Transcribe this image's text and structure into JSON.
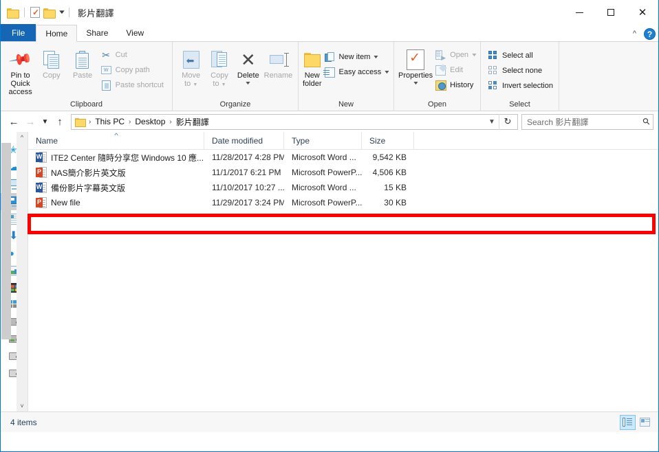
{
  "window": {
    "title": "影片翻譯",
    "quick_access": [
      {
        "name": "folder-icon",
        "label": "Folder"
      },
      {
        "name": "properties-icon",
        "label": "Properties"
      },
      {
        "name": "new-folder-icon",
        "label": "New folder"
      },
      {
        "name": "customize-caret-icon",
        "label": "Customize Quick Access Toolbar"
      }
    ],
    "controls": {
      "minimize": "Minimize",
      "maximize": "Maximize",
      "close": "Close"
    }
  },
  "ribbon": {
    "tabs": [
      {
        "label": "File",
        "active": false,
        "kind": "file"
      },
      {
        "label": "Home",
        "active": true,
        "kind": "normal"
      },
      {
        "label": "Share",
        "active": false,
        "kind": "normal"
      },
      {
        "label": "View",
        "active": false,
        "kind": "normal"
      }
    ],
    "collapse_label": "Minimize the Ribbon",
    "help_label": "?",
    "groups": {
      "clipboard": {
        "label": "Clipboard",
        "pin_line1": "Pin to Quick",
        "pin_line2": "access",
        "copy": "Copy",
        "paste": "Paste",
        "cut": "Cut",
        "copy_path": "Copy path",
        "paste_shortcut": "Paste shortcut"
      },
      "organize": {
        "label": "Organize",
        "move_to_line1": "Move",
        "move_to_line2": "to",
        "copy_to_line1": "Copy",
        "copy_to_line2": "to",
        "delete": "Delete",
        "rename": "Rename"
      },
      "new": {
        "label": "New",
        "new_folder_line1": "New",
        "new_folder_line2": "folder",
        "new_item": "New item",
        "easy_access": "Easy access"
      },
      "open": {
        "label": "Open",
        "properties": "Properties",
        "open": "Open",
        "edit": "Edit",
        "history": "History"
      },
      "select": {
        "label": "Select",
        "select_all": "Select all",
        "select_none": "Select none",
        "invert_selection": "Invert selection"
      }
    }
  },
  "navbar": {
    "back": "Back",
    "forward": "Forward",
    "recent": "Recent locations",
    "up": "Up",
    "breadcrumb": [
      "This PC",
      "Desktop",
      "影片翻譯"
    ],
    "dropdown": "Previous locations",
    "refresh": "Refresh",
    "search_placeholder": "Search 影片翻譯"
  },
  "nav_pane": {
    "items": [
      {
        "icon": "quick-access-star-icon",
        "label": "Quick access",
        "selected": false
      },
      {
        "icon": "onedrive-cloud-icon",
        "label": "OneDrive",
        "selected": false
      },
      {
        "icon": "this-pc-icon",
        "label": "This PC",
        "selected": false
      },
      {
        "icon": "desktop-icon",
        "label": "Desktop",
        "selected": true
      },
      {
        "icon": "documents-icon",
        "label": "Documents",
        "selected": false
      },
      {
        "icon": "downloads-icon",
        "label": "Downloads",
        "selected": false
      },
      {
        "icon": "music-icon",
        "label": "Music",
        "selected": false
      },
      {
        "icon": "pictures-icon",
        "label": "Pictures",
        "selected": false
      },
      {
        "icon": "videos-icon",
        "label": "Videos",
        "selected": false
      },
      {
        "icon": "windows-drive-icon",
        "label": "Local Disk",
        "selected": false
      },
      {
        "icon": "drive-icon",
        "label": "Drive",
        "selected": false
      },
      {
        "icon": "drive-green-icon",
        "label": "Drive",
        "selected": false
      },
      {
        "icon": "drive-grey-icon",
        "label": "Drive",
        "selected": false
      },
      {
        "icon": "drive-grey2-icon",
        "label": "Drive",
        "selected": false
      }
    ]
  },
  "file_list": {
    "columns": [
      {
        "key": "name",
        "label": "Name",
        "sorted": "asc"
      },
      {
        "key": "date",
        "label": "Date modified",
        "sorted": null
      },
      {
        "key": "type",
        "label": "Type",
        "sorted": null
      },
      {
        "key": "size",
        "label": "Size",
        "sorted": null
      }
    ],
    "rows": [
      {
        "icon": "word-document-icon",
        "badge": "W",
        "name": "ITE2 Center 隨時分享您 Windows 10 應...",
        "date": "11/28/2017 4:28 PM",
        "type": "Microsoft Word ...",
        "size": "9,542 KB",
        "highlighted": false
      },
      {
        "icon": "powerpoint-document-icon",
        "badge": "P",
        "name": "NAS簡介影片英文版",
        "date": "11/1/2017 6:21 PM",
        "type": "Microsoft PowerP...",
        "size": "4,506 KB",
        "highlighted": false
      },
      {
        "icon": "word-document-icon",
        "badge": "W",
        "name": "備份影片字幕英文版",
        "date": "11/10/2017 10:27 ...",
        "type": "Microsoft Word ...",
        "size": "15 KB",
        "highlighted": false
      },
      {
        "icon": "powerpoint-document-icon",
        "badge": "P",
        "name": "New file",
        "date": "11/29/2017 3:24 PM",
        "type": "Microsoft PowerP...",
        "size": "30 KB",
        "highlighted": true
      }
    ],
    "annotation_color": "#ff0000"
  },
  "status_bar": {
    "item_count": "4 items",
    "views": [
      {
        "name": "details-view-button",
        "label": "Details view",
        "active": true
      },
      {
        "name": "large-icons-view-button",
        "label": "Large icons view",
        "active": false
      }
    ]
  }
}
